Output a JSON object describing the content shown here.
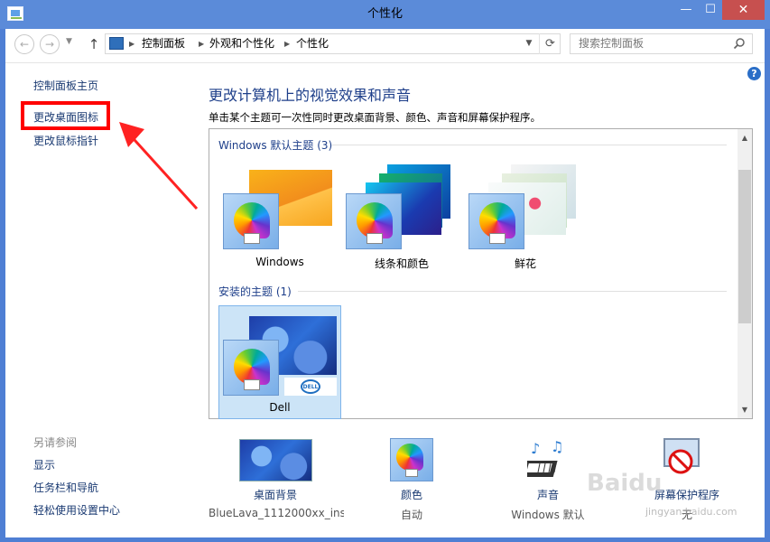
{
  "window": {
    "title": "个性化",
    "minimize_glyph": "—",
    "maximize_glyph": "☐",
    "close_glyph": "✕"
  },
  "address_bar": {
    "crumbs": [
      "控制面板",
      "外观和个性化",
      "个性化"
    ],
    "separator_glyph": "▶",
    "dropdown_glyph": "▼",
    "refresh_glyph": "⟳"
  },
  "nav": {
    "back_glyph": "←",
    "forward_glyph": "→",
    "history_glyph": "▼",
    "up_glyph": "↑"
  },
  "search": {
    "placeholder": "搜索控制面板",
    "icon": "search-icon"
  },
  "help": {
    "glyph": "?"
  },
  "sidebar": {
    "items": [
      {
        "label": "控制面板主页"
      },
      {
        "label": "更改桌面图标"
      },
      {
        "label": "更改鼠标指针"
      }
    ],
    "see_also_title": "另请参阅",
    "see_also": [
      {
        "label": "显示"
      },
      {
        "label": "任务栏和导航"
      },
      {
        "label": "轻松使用设置中心"
      }
    ]
  },
  "main": {
    "heading": "更改计算机上的视觉效果和声音",
    "description": "单击某个主题可一次性同时更改桌面背景、颜色、声音和屏幕保护程序。",
    "groups": [
      {
        "title": "Windows 默认主题 (3)",
        "themes": [
          {
            "label": "Windows"
          },
          {
            "label": "线条和颜色"
          },
          {
            "label": "鲜花"
          }
        ]
      },
      {
        "title": "安装的主题 (1)",
        "themes": [
          {
            "label": "Dell",
            "selected": true,
            "logo_text": "DELL"
          }
        ]
      }
    ],
    "scroll_up_glyph": "▲",
    "scroll_down_glyph": "▼"
  },
  "bottom": {
    "background": {
      "label": "桌面背景",
      "value": "BlueLava_1112000xx_ins..."
    },
    "color": {
      "label": "颜色",
      "value": "自动"
    },
    "sound": {
      "label": "声音",
      "value": "Windows 默认"
    },
    "screensaver": {
      "label": "屏幕保护程序",
      "value": "无"
    }
  },
  "watermark": {
    "text": "Baidu",
    "url": "jingyan.baidu.com"
  },
  "colors": {
    "title_bar": "#5b8bd9",
    "close_button": "#c7504f",
    "link": "#1a3a72",
    "heading": "#1e3f8a",
    "highlight_box": "#ff0000",
    "selection": "#cce4f7"
  }
}
